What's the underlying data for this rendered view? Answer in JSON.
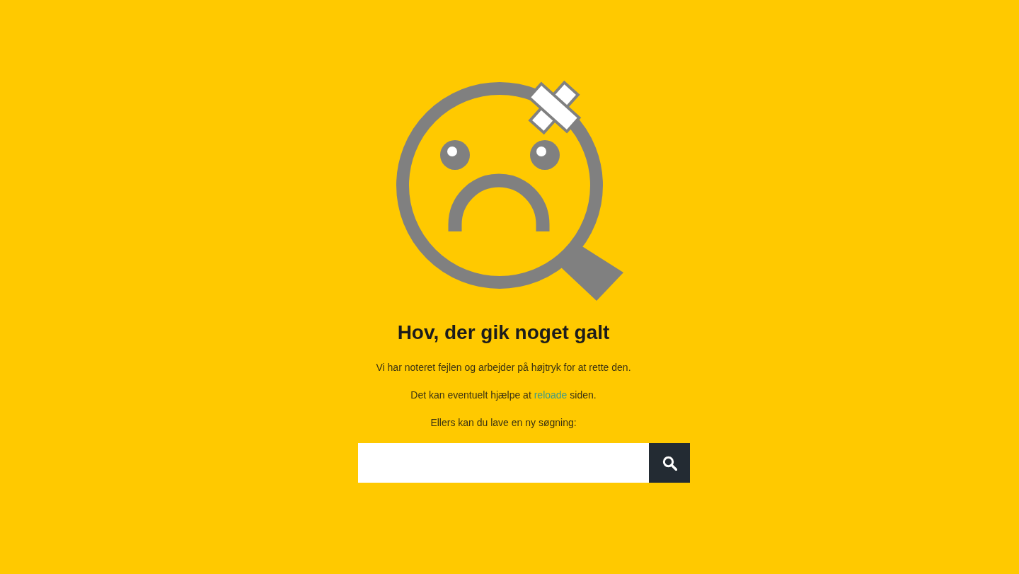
{
  "heading": "Hov, der gik noget galt",
  "paragraphs": [
    {
      "kind": "text",
      "text": "Vi har noteret fejlen og arbejder på højtryk for at rette den."
    },
    {
      "kind": "link",
      "before": "Det kan eventuelt hjælpe at",
      "link": "reloade",
      "after": "siden."
    },
    {
      "kind": "text",
      "text": "Ellers kan du lave en ny søgning:"
    }
  ]
}
